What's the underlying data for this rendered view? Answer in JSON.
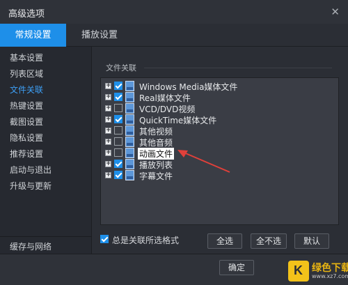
{
  "window": {
    "title": "高级选项",
    "close_glyph": "✕"
  },
  "tabs": [
    {
      "label": "常规设置",
      "active": true
    },
    {
      "label": "播放设置",
      "active": false
    }
  ],
  "sidebar": {
    "items": [
      {
        "label": "基本设置",
        "active": false
      },
      {
        "label": "列表区域",
        "active": false
      },
      {
        "label": "文件关联",
        "active": true
      },
      {
        "label": "热键设置",
        "active": false
      },
      {
        "label": "截图设置",
        "active": false
      },
      {
        "label": "隐私设置",
        "active": false
      },
      {
        "label": "推荐设置",
        "active": false
      },
      {
        "label": "启动与退出",
        "active": false
      },
      {
        "label": "升级与更新",
        "active": false
      }
    ],
    "bottom_item": {
      "label": "缓存与网络"
    }
  },
  "file_assoc": {
    "group_label": "文件关联",
    "items": [
      {
        "label": "Windows Media媒体文件",
        "checked": true
      },
      {
        "label": "Real媒体文件",
        "checked": true
      },
      {
        "label": "VCD/DVD视频",
        "checked": false
      },
      {
        "label": "QuickTime媒体文件",
        "checked": true
      },
      {
        "label": "其他视频",
        "checked": false
      },
      {
        "label": "其他音频",
        "checked": false
      },
      {
        "label": "动画文件",
        "checked": false,
        "highlighted": true
      },
      {
        "label": "播放列表",
        "checked": true
      },
      {
        "label": "字幕文件",
        "checked": true
      }
    ],
    "always_assoc": {
      "label": "总是关联所选格式",
      "checked": true
    },
    "buttons": {
      "select_all": "全选",
      "select_none": "全不选",
      "default": "默认"
    }
  },
  "footer": {
    "ok_label": "确定"
  },
  "watermark": {
    "text": "绿色下载",
    "sub": "www.xz7.com",
    "glyph": "K"
  },
  "colors": {
    "accent": "#1e8fe9",
    "arrow": "#e0403a",
    "bg": "#2b2e35"
  }
}
